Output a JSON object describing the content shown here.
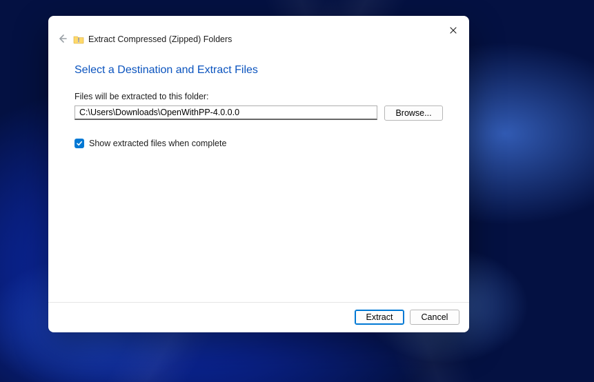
{
  "dialog": {
    "wizard_title": "Extract Compressed (Zipped) Folders",
    "heading": "Select a Destination and Extract Files",
    "path_label": "Files will be extracted to this folder:",
    "path_value": "C:\\Users\\Downloads\\OpenWithPP-4.0.0.0",
    "browse_label": "Browse...",
    "checkbox_label": "Show extracted files when complete",
    "checkbox_checked": true,
    "footer": {
      "extract_label": "Extract",
      "cancel_label": "Cancel"
    }
  },
  "icons": {
    "close": "close-icon",
    "back": "back-arrow-icon",
    "folder": "zip-folder-icon",
    "check": "checkmark-icon"
  }
}
